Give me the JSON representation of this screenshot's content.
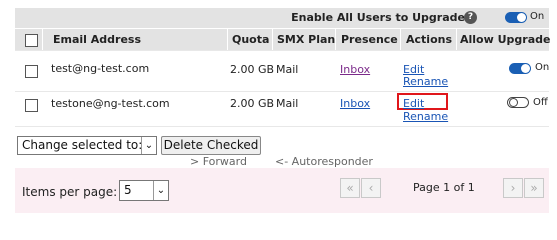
{
  "top_bar": {
    "enable_label": "Enable All Users to Upgrade",
    "toggle_label": "On"
  },
  "table": {
    "columns": [
      "Email Address",
      "Quota",
      "SMX Plan",
      "Presence",
      "Actions",
      "Allow Upgrade"
    ],
    "rows": [
      {
        "email": "test@ng-test.com",
        "quota": "2.00 GB",
        "plan": "Mail",
        "presence": "Inbox",
        "edit": "Edit",
        "rename": "Rename",
        "upgrade": "On"
      },
      {
        "email": "testone@ng-test.com",
        "quota": "2.00 GB",
        "plan": "Mail",
        "presence": "Inbox",
        "edit": "Edit",
        "rename": "Rename",
        "upgrade": "Off"
      }
    ]
  },
  "actions": {
    "change_selected_label": "Change selected to:",
    "delete_label": "Delete Checked",
    "forward_label": "> Forward",
    "autoresponder_label": "<- Autoresponder"
  },
  "footer": {
    "items_per_page_label": "Items per page:",
    "items_per_page_value": "5",
    "page_info": "Page 1 of 1",
    "first": "«",
    "prev": "‹",
    "next": "›",
    "last": "»"
  }
}
